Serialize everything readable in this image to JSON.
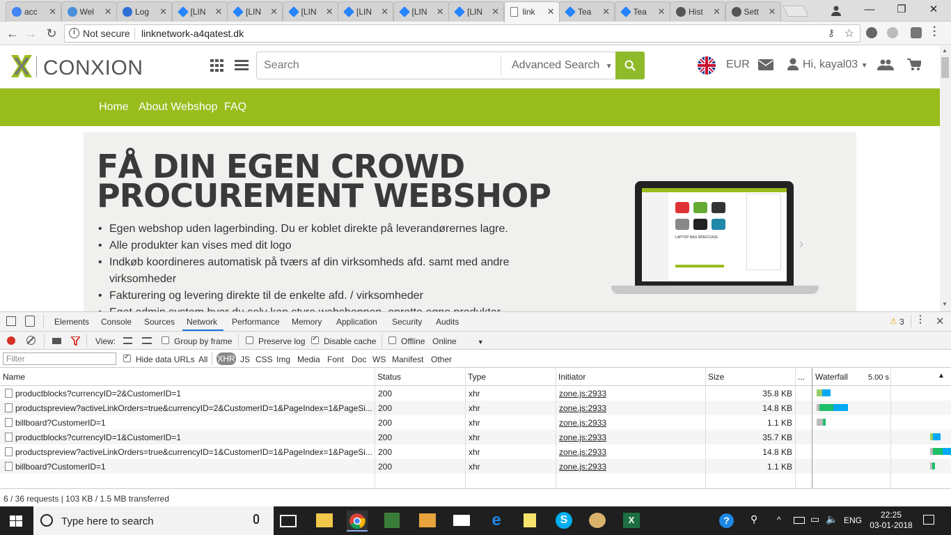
{
  "browser": {
    "tabs": [
      {
        "label": "acc",
        "icon": "google-icon",
        "color": "#4285f4"
      },
      {
        "label": "Wel",
        "icon": "globe-icon",
        "color": "#4a90d9"
      },
      {
        "label": "Log",
        "icon": "triangle-logo-icon",
        "color": "#2d6fd6"
      },
      {
        "label": "[LIN",
        "icon": "jira-icon",
        "color": "#2684ff"
      },
      {
        "label": "[LIN",
        "icon": "jira-icon",
        "color": "#2684ff"
      },
      {
        "label": "[LIN",
        "icon": "jira-icon",
        "color": "#2684ff"
      },
      {
        "label": "[LIN",
        "icon": "jira-icon",
        "color": "#2684ff"
      },
      {
        "label": "[LIN",
        "icon": "jira-icon",
        "color": "#2684ff"
      },
      {
        "label": "[LIN",
        "icon": "jira-icon",
        "color": "#2684ff"
      },
      {
        "label": "link",
        "icon": "page-icon",
        "color": "#777777",
        "active": true
      },
      {
        "label": "Tea",
        "icon": "jira-icon",
        "color": "#2684ff"
      },
      {
        "label": "Tea",
        "icon": "jira-icon",
        "color": "#2684ff"
      },
      {
        "label": "Hist",
        "icon": "history-icon",
        "color": "#555555"
      },
      {
        "label": "Sett",
        "icon": "gear-icon",
        "color": "#555555"
      }
    ],
    "security_label": "Not secure",
    "url": "linknetwork-a4qatest.dk"
  },
  "site": {
    "logo_text": "CONXION",
    "search_placeholder": "Search",
    "advanced_search": "Advanced Search",
    "currency": "EUR",
    "greeting": "Hi, kayal03",
    "menu": [
      "Home",
      "About Webshop",
      "FAQ"
    ],
    "banner": {
      "headline_line1": "FÅ DIN EGEN CROWD",
      "headline_line2": "PROCUREMENT WEBSHOP",
      "bullets": [
        "Egen webshop uden lagerbinding. Du er koblet direkte på leverandørernes lagre.",
        "Alle produkter kan vises med dit logo",
        "Indkøb koordineres automatisk på tværs af din virksomheds afd. samt med andre virksomheder",
        "Fakturering og levering direkte til de enkelte afd. / virksomheder",
        "Eget admin system hvor du selv kan styre webshoppen, oprette egne produkter"
      ],
      "laptop_screen_title": "LAPTOP BAG BRIEFCASE"
    },
    "colors": {
      "brand_green": "#98bd1c",
      "search_button": "#8fba2a"
    }
  },
  "devtools": {
    "tabs": [
      "Elements",
      "Console",
      "Sources",
      "Network",
      "Performance",
      "Memory",
      "Application",
      "Security",
      "Audits"
    ],
    "selected_tab": "Network",
    "warning_count": "3",
    "toolbar": {
      "view_label": "View:",
      "group_by_frame": "Group by frame",
      "preserve_log": "Preserve log",
      "disable_cache": "Disable cache",
      "offline": "Offline",
      "throttle": "Online"
    },
    "filter_bar": {
      "placeholder": "Filter",
      "hide_data_urls": "Hide data URLs",
      "types": [
        "All",
        "XHR",
        "JS",
        "CSS",
        "Img",
        "Media",
        "Font",
        "Doc",
        "WS",
        "Manifest",
        "Other"
      ],
      "selected_type": "XHR"
    },
    "columns": [
      "Name",
      "Status",
      "Type",
      "Initiator",
      "Size",
      "...",
      "Waterfall"
    ],
    "waterfall_scale": "5.00 s",
    "rows": [
      {
        "name": "productblocks?currencyID=2&CustomerID=1",
        "status": "200",
        "type": "xhr",
        "initiator": "zone.js:2933",
        "size": "35.8 KB"
      },
      {
        "name": "productspreview?activeLinkOrders=true&currencyID=2&CustomerID=1&PageIndex=1&PageSi...",
        "status": "200",
        "type": "xhr",
        "initiator": "zone.js:2933",
        "size": "14.8 KB"
      },
      {
        "name": "billboard?CustomerID=1",
        "status": "200",
        "type": "xhr",
        "initiator": "zone.js:2933",
        "size": "1.1 KB"
      },
      {
        "name": "productblocks?currencyID=1&CustomerID=1",
        "status": "200",
        "type": "xhr",
        "initiator": "zone.js:2933",
        "size": "35.7 KB"
      },
      {
        "name": "productspreview?activeLinkOrders=true&currencyID=1&CustomerID=1&PageIndex=1&PageSi...",
        "status": "200",
        "type": "xhr",
        "initiator": "zone.js:2933",
        "size": "14.8 KB"
      },
      {
        "name": "billboard?CustomerID=1",
        "status": "200",
        "type": "xhr",
        "initiator": "zone.js:2933",
        "size": "1.1 KB"
      }
    ],
    "summary": "6 / 36 requests  |  103 KB / 1.5 MB transferred"
  },
  "taskbar": {
    "search_placeholder": "Type here to search",
    "language": "ENG",
    "time": "22:25",
    "date": "03-01-2018"
  }
}
